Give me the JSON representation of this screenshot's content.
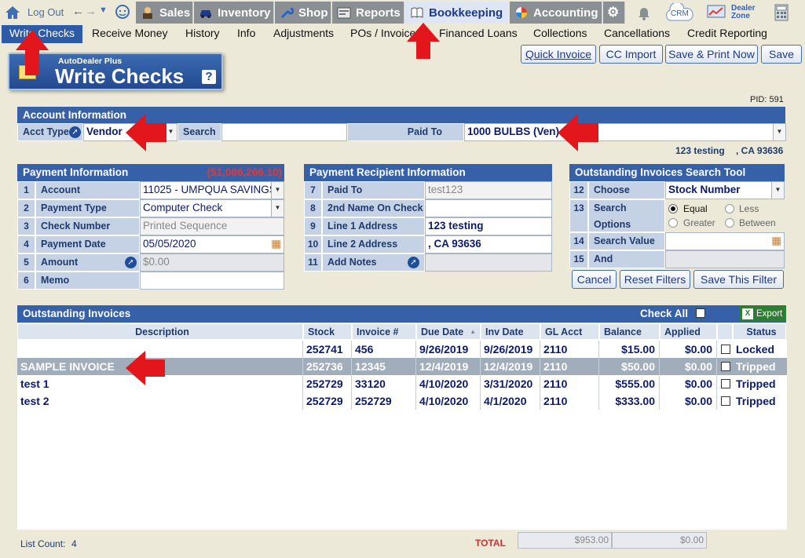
{
  "topnav": {
    "logout": "Log Out",
    "tabs": [
      {
        "label": "Sales",
        "icon": "salesperson-icon"
      },
      {
        "label": "Inventory",
        "icon": "car-icon"
      },
      {
        "label": "Shop",
        "icon": "wrench-icon"
      },
      {
        "label": "Reports",
        "icon": "report-icon"
      },
      {
        "label": "Bookkeeping",
        "icon": "book-icon"
      },
      {
        "label": "Accounting",
        "icon": "pie-chart-icon"
      }
    ],
    "crm": "CRM",
    "dealer_zone": "Dealer Zone"
  },
  "subnav": [
    "Write Checks",
    "Receive Money",
    "History",
    "Info",
    "Adjustments",
    "POs / Invoices",
    "Financed Loans",
    "Collections",
    "Cancellations",
    "Credit Reporting"
  ],
  "actions": {
    "quick_invoice": "Quick Invoice",
    "cc_import": "CC Import",
    "save_print": "Save & Print Now",
    "save": "Save"
  },
  "title": {
    "brand": "AutoDealer Plus",
    "main": "Write Checks",
    "help": "?"
  },
  "pid": "PID: 591",
  "account_info": {
    "header": "Account Information",
    "acct_type_label": "Acct Type",
    "acct_type": "Vendor",
    "search_label": "Search",
    "search_value": "",
    "paid_to_label": "Paid To",
    "paid_to": "1000 BULBS (Ven)",
    "address_line": "123 testing",
    "city_line": ", CA 93636"
  },
  "payment_info": {
    "header": "Payment Information",
    "balance": "($1,086,266.10)",
    "rows": [
      {
        "num": "1",
        "label": "Account",
        "value": "11025 - UMPQUA SAVINGS"
      },
      {
        "num": "2",
        "label": "Payment Type",
        "value": "Computer Check"
      },
      {
        "num": "3",
        "label": "Check Number",
        "value": "Printed Sequence"
      },
      {
        "num": "4",
        "label": "Payment Date",
        "value": "05/05/2020"
      },
      {
        "num": "5",
        "label": "Amount",
        "value": "$0.00"
      },
      {
        "num": "6",
        "label": "Memo",
        "value": ""
      }
    ]
  },
  "recipient_info": {
    "header": "Payment Recipient Information",
    "rows": [
      {
        "num": "7",
        "label": "Paid To",
        "value": "test123"
      },
      {
        "num": "8",
        "label": "2nd Name On Check",
        "value": ""
      },
      {
        "num": "9",
        "label": "Line 1 Address",
        "value": "123 testing"
      },
      {
        "num": "10",
        "label": "Line 2 Address",
        "value": ", CA 93636"
      },
      {
        "num": "11",
        "label": "Add Notes",
        "value": ""
      }
    ]
  },
  "search_tool": {
    "header": "Outstanding Invoices Search Tool",
    "rows": [
      {
        "num": "12",
        "label": "Choose Search",
        "value": "Stock Number"
      },
      {
        "num": "13",
        "label": "Search Options"
      },
      {
        "num": "14",
        "label": "Search Value",
        "value": ""
      },
      {
        "num": "15",
        "label": "And",
        "value": ""
      }
    ],
    "options": [
      "Equal",
      "Less",
      "Greater",
      "Between"
    ],
    "selected_option": "Equal",
    "buttons": {
      "cancel": "Cancel",
      "reset": "Reset Filters",
      "save_filter": "Save This Filter"
    }
  },
  "invoices": {
    "header": "Outstanding Invoices",
    "check_all": "Check All",
    "export": "Export",
    "columns": [
      "Description",
      "Stock",
      "Invoice #",
      "Due Date",
      "Inv Date",
      "GL Acct",
      "Balance",
      "Applied",
      "",
      "Status"
    ],
    "rows": [
      {
        "description": "",
        "stock": "252741",
        "invoice": "456",
        "due": "9/26/2019",
        "inv": "9/26/2019",
        "gl": "2110",
        "balance": "$15.00",
        "applied": "$0.00",
        "status": "Locked"
      },
      {
        "description": "SAMPLE INVOICE",
        "stock": "252736",
        "invoice": "12345",
        "due": "12/4/2019",
        "inv": "12/4/2019",
        "gl": "2110",
        "balance": "$50.00",
        "applied": "$0.00",
        "status": "Tripped"
      },
      {
        "description": "test 1",
        "stock": "252729",
        "invoice": "33120",
        "due": "4/10/2020",
        "inv": "3/31/2020",
        "gl": "2110",
        "balance": "$555.00",
        "applied": "$0.00",
        "status": "Tripped"
      },
      {
        "description": "test 2",
        "stock": "252729",
        "invoice": "252729",
        "due": "4/10/2020",
        "inv": "4/1/2020",
        "gl": "2110",
        "balance": "$333.00",
        "applied": "$0.00",
        "status": "Tripped"
      }
    ],
    "list_count_label": "List Count:",
    "list_count": "4",
    "total_label": "TOTAL",
    "total_balance": "$953.00",
    "total_applied": "$0.00"
  }
}
